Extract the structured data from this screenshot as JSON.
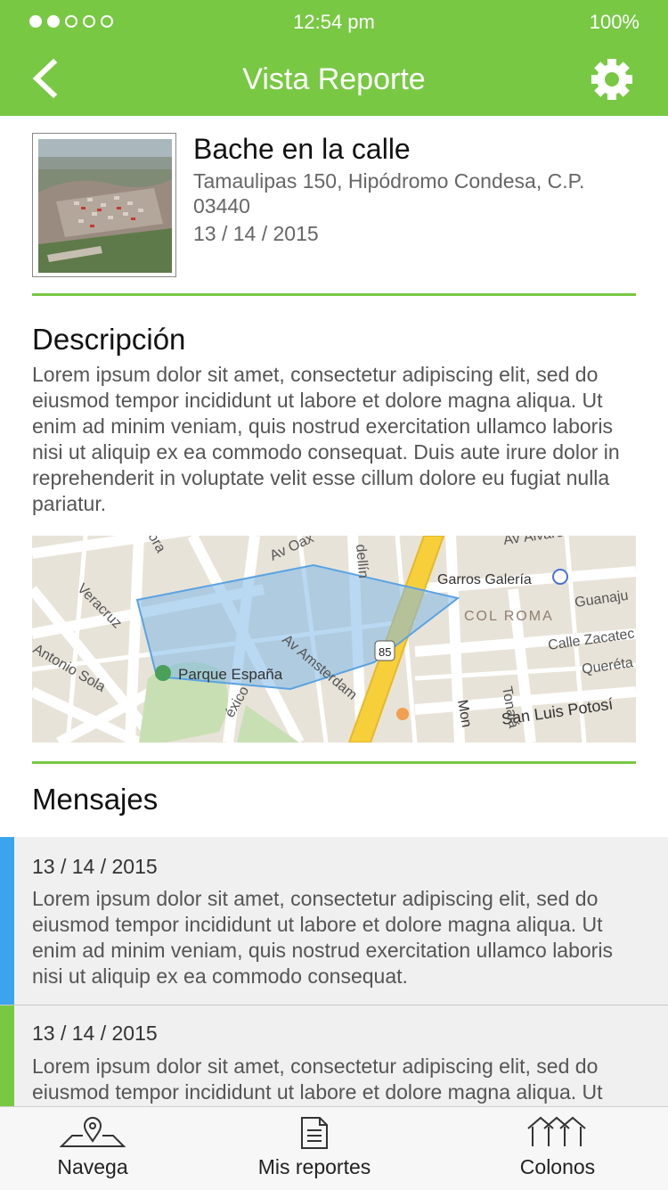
{
  "status": {
    "time": "12:54 pm",
    "battery": "100%"
  },
  "nav": {
    "title": "Vista Reporte",
    "back_icon": "chevron-left-icon",
    "settings_icon": "gear-icon"
  },
  "report": {
    "title": "Bache en la calle",
    "address": "Tamaulipas 150, Hipódromo Condesa, C.P. 03440",
    "date": "13 / 14 / 2015"
  },
  "description": {
    "heading": "Descripción",
    "text": "Lorem ipsum dolor sit amet, consectetur adipiscing elit, sed do eiusmod tempor incididunt ut labore et dolore magna aliqua. Ut enim ad minim veniam, quis nostrud exercitation ullamco laboris nisi ut aliquip ex ea commodo consequat. Duis aute irure dolor in reprehenderit in voluptate velit esse cillum dolore eu fugiat nulla pariatur."
  },
  "map": {
    "labels": [
      "Av Oax",
      "Av Álvaro Obr",
      "Garros Galería",
      "COL ROMA",
      "Guanaju",
      "Calle Zacatec",
      "Queréta",
      "San Luis Potosí",
      "Parque España",
      "Av Amsterdam",
      "Veracruz",
      "Antonio Sola",
      "Tonalá",
      "85",
      "dellín",
      "ora",
      "éxico",
      "Mon"
    ]
  },
  "messages": {
    "heading": "Mensajes",
    "items": [
      {
        "date": "13 / 14 / 2015",
        "text": "Lorem ipsum dolor sit amet, consectetur adipiscing elit, sed do eiusmod tempor incididunt ut labore et dolore magna aliqua. Ut enim ad minim veniam, quis nostrud exercitation ullamco laboris nisi ut aliquip ex ea commodo consequat.",
        "accent": "#3aa5ee"
      },
      {
        "date": "13 / 14 / 2015",
        "text": "Lorem ipsum dolor sit amet, consectetur adipiscing elit, sed do eiusmod tempor incididunt ut labore et dolore magna aliqua. Ut",
        "accent": "#78c843"
      }
    ]
  },
  "tabs": [
    {
      "label": "Navega",
      "icon": "map-pin-icon"
    },
    {
      "label": "Mis reportes",
      "icon": "document-icon"
    },
    {
      "label": "Colonos",
      "icon": "houses-icon"
    }
  ],
  "colors": {
    "brand": "#78c843",
    "accent_blue": "#3aa5ee"
  }
}
